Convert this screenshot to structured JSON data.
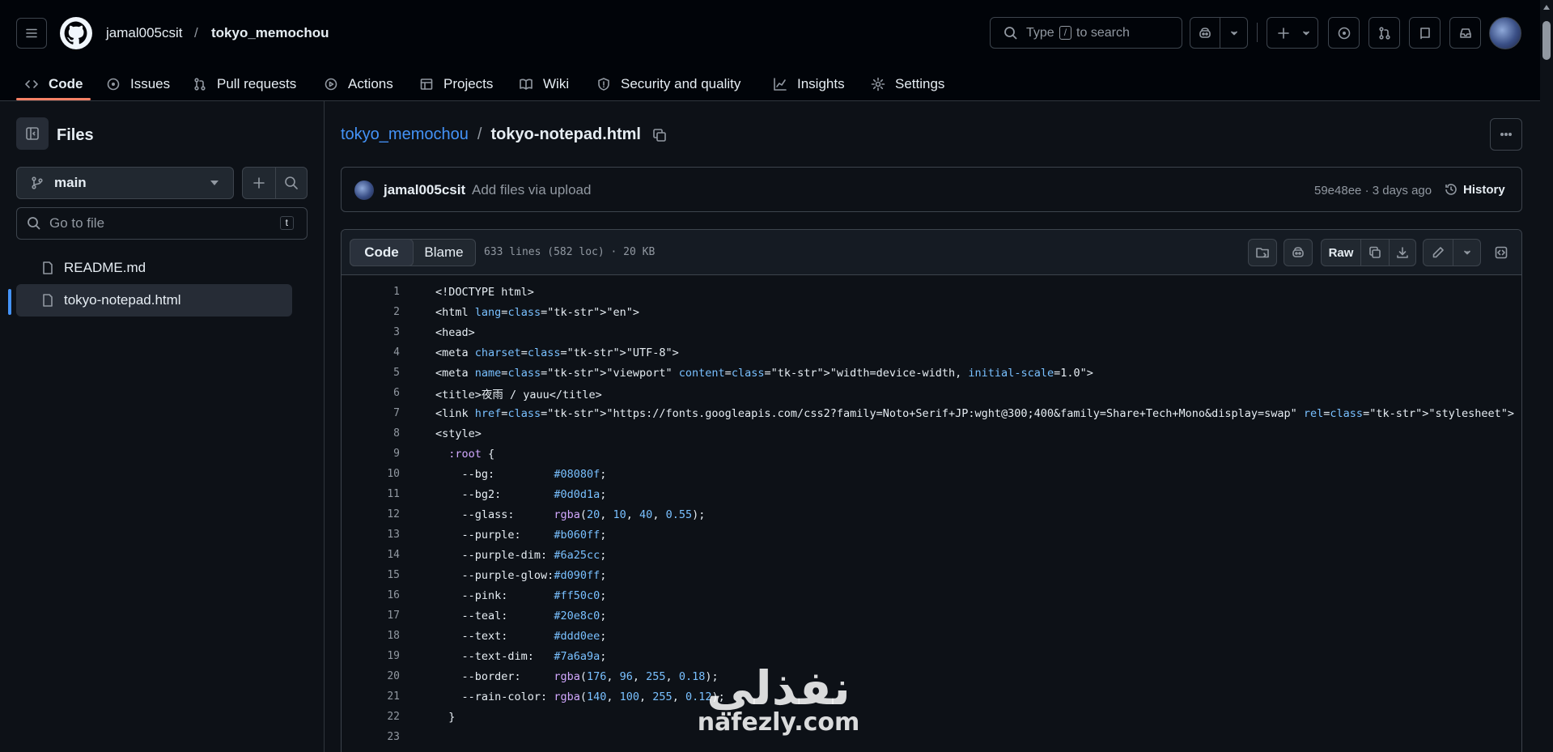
{
  "header": {
    "owner": "jamal005csit",
    "separator": "/",
    "repo": "tokyo_memochou",
    "search_prefix": "Type",
    "search_key": "/",
    "search_suffix": "to search"
  },
  "tabs": [
    {
      "label": "Code",
      "icon": "code-icon"
    },
    {
      "label": "Issues",
      "icon": "issue-icon"
    },
    {
      "label": "Pull requests",
      "icon": "pull-request-icon"
    },
    {
      "label": "Actions",
      "icon": "play-icon"
    },
    {
      "label": "Projects",
      "icon": "table-icon"
    },
    {
      "label": "Wiki",
      "icon": "book-icon"
    },
    {
      "label": "Security and quality",
      "icon": "shield-icon"
    },
    {
      "label": "Insights",
      "icon": "graph-icon"
    },
    {
      "label": "Settings",
      "icon": "gear-icon"
    }
  ],
  "sidebar": {
    "title": "Files",
    "branch": "main",
    "goto_placeholder": "Go to file",
    "goto_key": "t",
    "files": [
      {
        "name": "README.md",
        "selected": false
      },
      {
        "name": "tokyo-notepad.html",
        "selected": true
      }
    ]
  },
  "breadcrumb": {
    "repo": "tokyo_memochou",
    "separator": "/",
    "file": "tokyo-notepad.html"
  },
  "commit": {
    "author": "jamal005csit",
    "message": "Add files via upload",
    "meta": "59e48ee · 3 days ago",
    "history_label": "History"
  },
  "code_view": {
    "tab_code": "Code",
    "tab_blame": "Blame",
    "stats": "633 lines (582 loc) · 20 KB",
    "raw_label": "Raw",
    "lines": [
      {
        "n": "1",
        "t": "<!DOCTYPE html>"
      },
      {
        "n": "2",
        "t": "<html lang=\"en\">"
      },
      {
        "n": "3",
        "t": "<head>"
      },
      {
        "n": "4",
        "t": "<meta charset=\"UTF-8\">"
      },
      {
        "n": "5",
        "t": "<meta name=\"viewport\" content=\"width=device-width, initial-scale=1.0\">"
      },
      {
        "n": "6",
        "t": "<title>夜雨 / yauu</title>"
      },
      {
        "n": "7",
        "t": "<link href=\"https://fonts.googleapis.com/css2?family=Noto+Serif+JP:wght@300;400&family=Share+Tech+Mono&display=swap\" rel=\"stylesheet\">"
      },
      {
        "n": "8",
        "t": "<style>"
      },
      {
        "n": "9",
        "t": "  :root {"
      },
      {
        "n": "10",
        "t": "    --bg:         #08080f;"
      },
      {
        "n": "11",
        "t": "    --bg2:        #0d0d1a;"
      },
      {
        "n": "12",
        "t": "    --glass:      rgba(20, 10, 40, 0.55);"
      },
      {
        "n": "13",
        "t": "    --purple:     #b060ff;"
      },
      {
        "n": "14",
        "t": "    --purple-dim: #6a25cc;"
      },
      {
        "n": "15",
        "t": "    --purple-glow:#d090ff;"
      },
      {
        "n": "16",
        "t": "    --pink:       #ff50c0;"
      },
      {
        "n": "17",
        "t": "    --teal:       #20e8c0;"
      },
      {
        "n": "18",
        "t": "    --text:       #ddd0ee;"
      },
      {
        "n": "19",
        "t": "    --text-dim:   #7a6a9a;"
      },
      {
        "n": "20",
        "t": "    --border:     rgba(176, 96, 255, 0.18);"
      },
      {
        "n": "21",
        "t": "    --rain-color: rgba(140, 100, 255, 0.12);"
      },
      {
        "n": "22",
        "t": "  }"
      },
      {
        "n": "23",
        "t": ""
      }
    ]
  },
  "watermark": {
    "arabic": "نفذلي",
    "latin": "nafezly.com"
  },
  "colors": {
    "accent": "#4493f8",
    "tab_underline": "#f78166",
    "bg": "#0d1117",
    "header_bg": "#010409"
  }
}
